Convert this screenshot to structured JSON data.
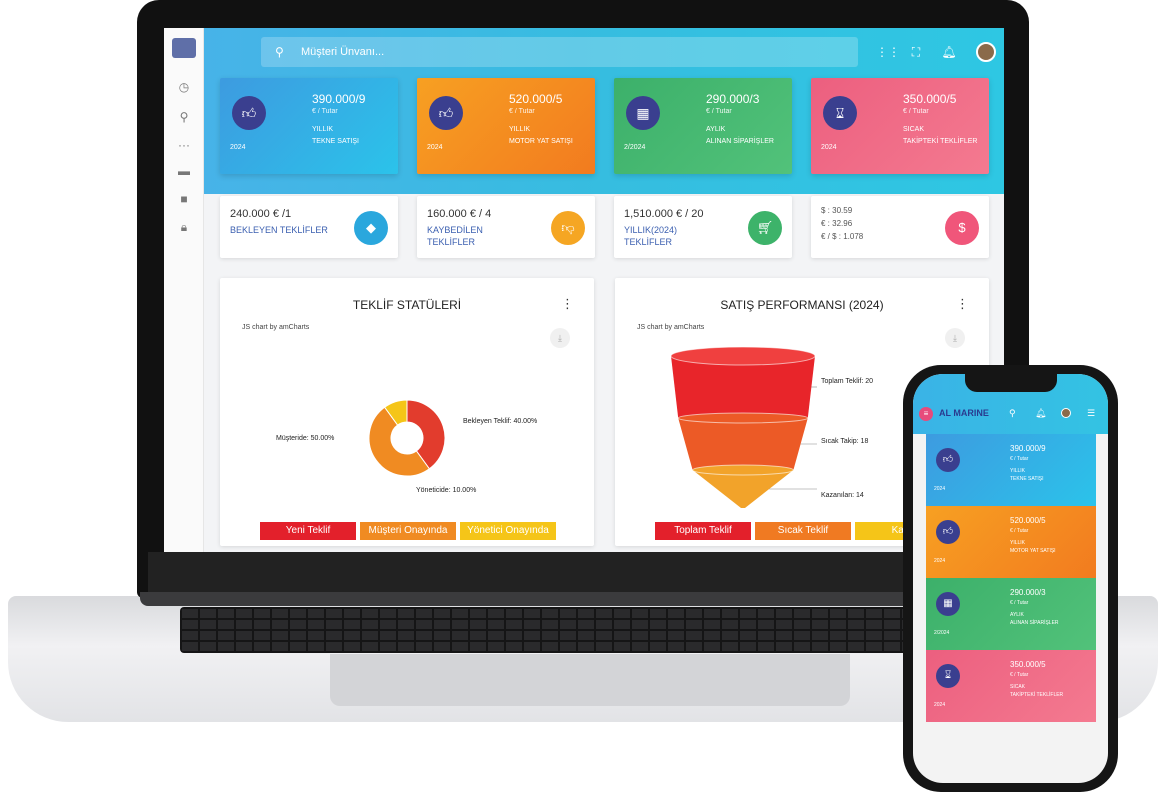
{
  "search": {
    "placeholder": "Müşteri Ünvanı..."
  },
  "stats": [
    {
      "value": "390.000/9",
      "unit": "€ / Tutar",
      "label1": "YILLIK",
      "label2": "TEKNE SATIŞI",
      "year": "2024",
      "icon": "thumbs-up-icon",
      "gradient": [
        "#3d9be0",
        "#2bc3ea"
      ]
    },
    {
      "value": "520.000/5",
      "unit": "€ / Tutar",
      "label1": "YILLIK",
      "label2": "MOTOR YAT SATIŞI",
      "year": "2024",
      "icon": "thumbs-up-icon",
      "gradient": [
        "#f7a022",
        "#f27b1f"
      ]
    },
    {
      "value": "290.000/3",
      "unit": "€ / Tutar",
      "label1": "AYLIK",
      "label2": "ALINAN SİPARİŞLER",
      "year": "2/2024",
      "icon": "calendar-icon",
      "gradient": [
        "#3cb06a",
        "#52c27a"
      ]
    },
    {
      "value": "350.000/5",
      "unit": "€ / Tutar",
      "label1": "SICAK",
      "label2": "TAKİPTEKİ TEKLİFLER",
      "year": "2024",
      "icon": "hourglass-icon",
      "gradient": [
        "#ec5f7f",
        "#f47a90"
      ]
    }
  ],
  "info": [
    {
      "value": "240.000 € /1",
      "label": "BEKLEYEN TEKLİFLER",
      "color": "#2aa7dd",
      "icon": "tag-icon"
    },
    {
      "value": "160.000 € / 4",
      "label": "KAYBEDİLEN TEKLİFLER",
      "color": "#f5a623",
      "icon": "thumbs-down-icon"
    },
    {
      "value": "1,510.000 € / 20",
      "label": "YILLIK(2024) TEKLİFLER",
      "color": "#3db36a",
      "icon": "cart-icon"
    }
  ],
  "rates": {
    "usd": "$    : 30.59",
    "eur": "€    : 32.96",
    "eurusd": "€ / $ : 1.078",
    "color": "#f0567a",
    "icon": "dollar-icon"
  },
  "panel1": {
    "title": "TEKLİF STATÜLERİ",
    "credit": "JS chart by amCharts",
    "legend": [
      "Yeni Teklif",
      "Müşteri Onayında",
      "Yönetici Onayında"
    ]
  },
  "panel2": {
    "title": "SATIŞ PERFORMANSI (2024)",
    "credit": "JS chart by amCharts",
    "legend": [
      "Toplam Teklif",
      "Sıcak Teklif",
      "Kaza"
    ]
  },
  "phone": {
    "logo": "AL MARINE",
    "cards": [
      {
        "value": "390.000/9",
        "unit": "€ / Tutar",
        "label1": "YILLIK",
        "label2": "TEKNE SATIŞI",
        "year": "2024"
      },
      {
        "value": "520.000/5",
        "unit": "€ / Tutar",
        "label1": "YILLIK",
        "label2": "MOTOR YAT SATIŞI",
        "year": "2024"
      },
      {
        "value": "290.000/3",
        "unit": "€ / Tutar",
        "label1": "AYLIK",
        "label2": "ALINAN SİPARİŞLER",
        "year": "2/2024"
      },
      {
        "value": "350.000/5",
        "unit": "€ / Tutar",
        "label1": "SICAK",
        "label2": "TAKİPTEKİ TEKLİFLER",
        "year": "2024"
      }
    ]
  },
  "chart_data": [
    {
      "type": "pie",
      "title": "TEKLİF STATÜLERİ",
      "categories": [
        "Bekleyen Teklif",
        "Müşteride",
        "Yöneticide"
      ],
      "values": [
        40,
        50,
        10
      ],
      "labels": [
        "Bekleyen Teklif: 40.00%",
        "Müşteride: 50.00%",
        "Yöneticide: 10.00%"
      ],
      "colors": [
        "#e23c2d",
        "#f08b22",
        "#f5c518"
      ],
      "donut": true
    },
    {
      "type": "bar",
      "title": "SATIŞ PERFORMANSI (2024)",
      "categories": [
        "Toplam Teklif",
        "Sıcak Takip",
        "Kazanılan"
      ],
      "values": [
        20,
        18,
        14
      ],
      "labels": [
        "Toplam Teklif: 20",
        "Sıcak Takip: 18",
        "Kazanılan: 14"
      ],
      "colors": [
        "#e8252a",
        "#ec5a26",
        "#f2a32a"
      ],
      "shape": "funnel"
    }
  ]
}
